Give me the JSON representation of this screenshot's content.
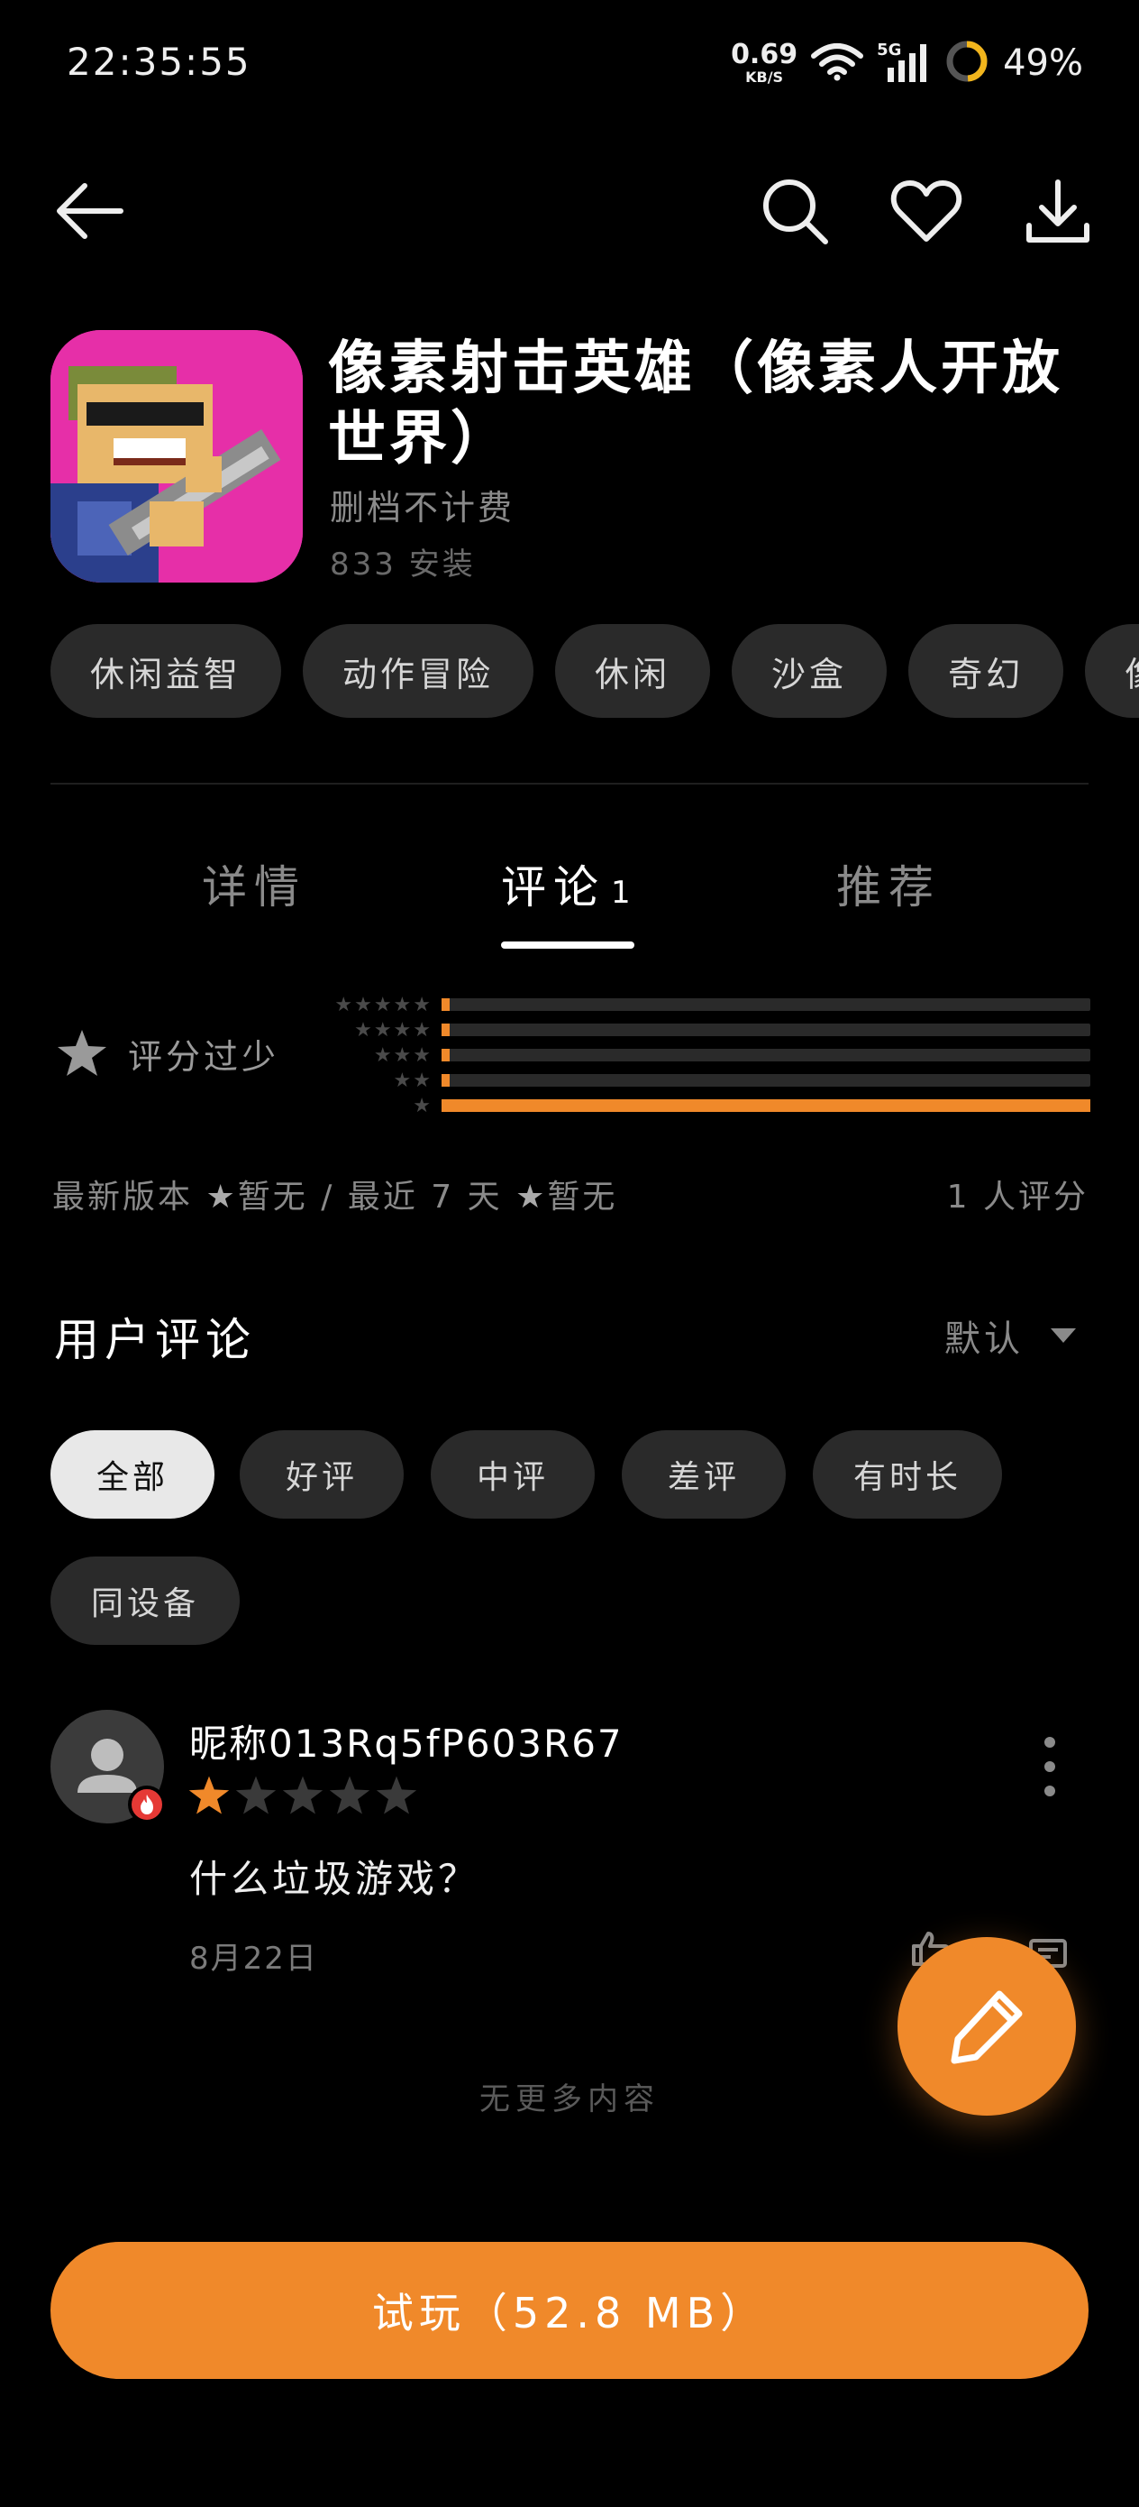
{
  "status_bar": {
    "time": "22:35:55",
    "net_speed_value": "0.69",
    "net_speed_unit": "KB/S",
    "network": "5G",
    "battery": "49%"
  },
  "nav": {
    "icons": [
      "back-arrow-icon",
      "search-icon",
      "heart-icon",
      "download-icon"
    ]
  },
  "app": {
    "title": "像素射击英雄（像素人开放世界）",
    "subtitle": "删档不计费",
    "installs": "833 安装"
  },
  "tags": [
    "休闲益智",
    "动作冒险",
    "休闲",
    "沙盒",
    "奇幻",
    "像"
  ],
  "tabs": {
    "details": "详情",
    "reviews": "评论",
    "reviews_count": "1",
    "recommend": "推荐",
    "active": "reviews"
  },
  "rating": {
    "label": "评分过少",
    "distribution": [
      {
        "stars": 5,
        "fraction": 0.01
      },
      {
        "stars": 4,
        "fraction": 0.01
      },
      {
        "stars": 3,
        "fraction": 0.01
      },
      {
        "stars": 2,
        "fraction": 0.01
      },
      {
        "stars": 1,
        "fraction": 1.0
      }
    ],
    "latest_version_label": "最新版本",
    "latest_version_value": "暂无",
    "separator": "/",
    "recent_label": "最近 7 天",
    "recent_value": "暂无",
    "count_text": "1 人评分"
  },
  "reviews_section": {
    "title": "用户评论",
    "sort_label": "默认",
    "filters": [
      "全部",
      "好评",
      "中评",
      "差评",
      "有时长",
      "同设备"
    ],
    "active_filter": "全部"
  },
  "review": {
    "name": "昵称013Rq5fP603R67",
    "stars": 1,
    "text": "什么垃圾游戏？",
    "date": "8月22日"
  },
  "footer": {
    "no_more": "无更多内容",
    "cta": "试玩（52.8 MB）"
  },
  "colors": {
    "accent": "#f0892a",
    "background": "#000000",
    "chip": "#2a2a2a"
  }
}
